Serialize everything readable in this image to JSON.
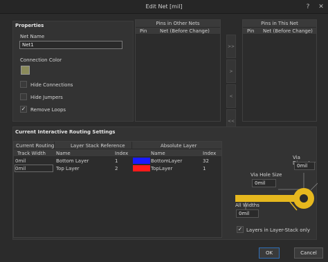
{
  "window": {
    "title": "Edit Net [mil]"
  },
  "properties": {
    "heading": "Properties",
    "net_name_label": "Net Name",
    "net_name_value": "Net1",
    "connection_color_label": "Connection Color",
    "connection_color": "#8a8a5a",
    "hide_connections": "Hide Connections",
    "hide_jumpers": "Hide Jumpers",
    "remove_loops": "Remove Loops"
  },
  "pins_other": {
    "title": "Pins in Other Nets",
    "col_pin": "Pin",
    "col_net": "Net (Before Change)"
  },
  "pins_this": {
    "title": "Pins in This Net",
    "col_pin": "Pin",
    "col_net": "Net (Before Change)"
  },
  "arrows": [
    ">>",
    ">",
    "<",
    "<<"
  ],
  "routing": {
    "heading": "Current Interactive Routing Settings",
    "current_routing": "Current Routing",
    "layer_stack_reference": "Layer Stack Reference",
    "absolute_layer": "Absolute Layer",
    "col_track_width": "Track Width",
    "col_name": "Name",
    "col_index": "Index",
    "col_name2": "Name",
    "col_index2": "Index",
    "rows": [
      {
        "width": "0mil",
        "layer": "Bottom Layer",
        "index": "1",
        "color": "#1a1aff",
        "abs_name": "BottomLayer",
        "abs_index": "32"
      },
      {
        "width": "0mil",
        "layer": "Top Layer",
        "index": "2",
        "color": "#ff1a1a",
        "abs_name": "TopLayer",
        "abs_index": "1"
      }
    ]
  },
  "diagram": {
    "via_diameter_label": "Via Diameter",
    "via_diameter_value": "0mil",
    "via_hole_label": "Via Hole Size",
    "via_hole_value": "0mil",
    "all_widths_label": "All Widths",
    "all_widths_value": "0mil"
  },
  "layers_only": "Layers in Layer-Stack only",
  "buttons": {
    "ok": "OK",
    "cancel": "Cancel"
  }
}
